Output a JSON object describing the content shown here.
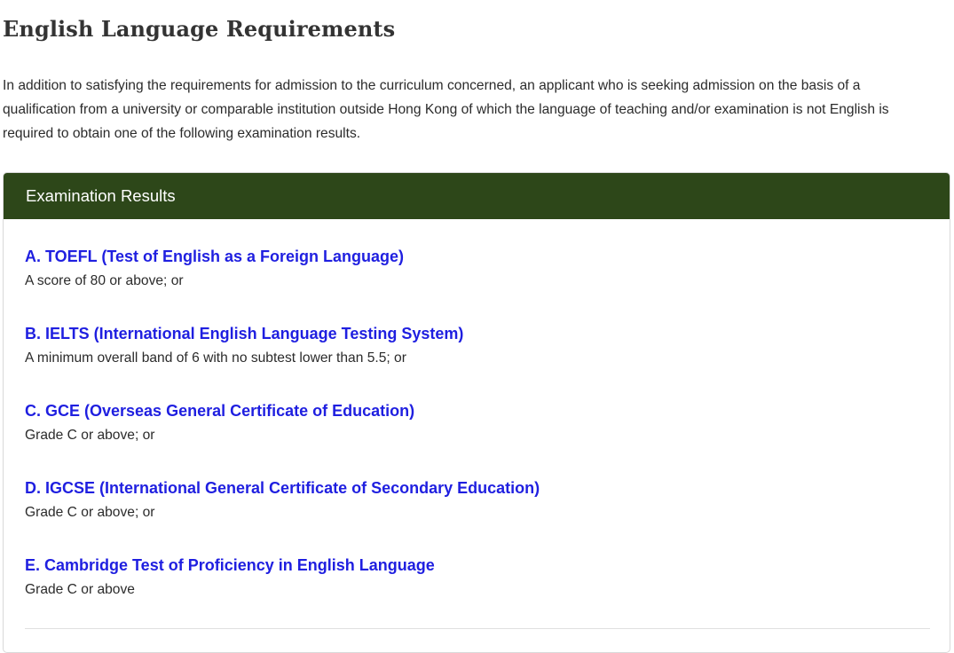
{
  "page": {
    "title": "English Language Requirements",
    "intro": "In addition to satisfying the requirements for admission to the curriculum concerned, an applicant who is seeking admission on the basis of a qualification from a university or comparable institution outside Hong Kong of which the language of teaching and/or examination is not English is required to obtain one of the following examination results."
  },
  "panel": {
    "header": "Examination Results",
    "items": [
      {
        "title": "A. TOEFL (Test of English as a Foreign Language)",
        "desc": "A score of 80 or above; or"
      },
      {
        "title": "B. IELTS (International English Language Testing System)",
        "desc": "A minimum overall band of 6 with no subtest lower than 5.5; or"
      },
      {
        "title": "C. GCE (Overseas General Certificate of Education)",
        "desc": "Grade C or above; or"
      },
      {
        "title": "D. IGCSE (International General Certificate of Secondary Education)",
        "desc": "Grade C or above; or"
      },
      {
        "title": "E. Cambridge Test of Proficiency in English Language",
        "desc": "Grade C or above"
      }
    ]
  },
  "colors": {
    "header_bg": "#2d4719",
    "link": "#1f1fe0"
  }
}
